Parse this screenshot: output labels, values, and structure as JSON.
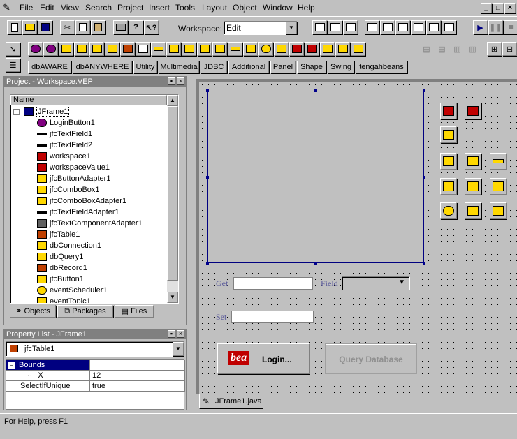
{
  "menu": [
    "File",
    "Edit",
    "View",
    "Search",
    "Project",
    "Insert",
    "Tools",
    "Layout",
    "Object",
    "Window",
    "Help"
  ],
  "toolbar": {
    "workspace_label": "Workspace:",
    "workspace_value": "Edit"
  },
  "palette_tabs": [
    "dbAWARE",
    "dbANYWHERE",
    "Utility",
    "Multimedia",
    "JDBC",
    "Additional",
    "Panel",
    "Shape",
    "Swing",
    "tengahbeans"
  ],
  "project_pane": {
    "title": "Project - Workspace.VEP",
    "column_name": "Name",
    "root": "JFrame1",
    "items": [
      "LoginButton1",
      "jfcTextField1",
      "jfcTextField2",
      "workspace1",
      "workspaceValue1",
      "jfcButtonAdapter1",
      "jfcComboBox1",
      "jfcComboBoxAdapter1",
      "jfcTextFieldAdapter1",
      "jfcTextComponentAdapter1",
      "jfcTable1",
      "dbConnection1",
      "dbQuery1",
      "dbRecord1",
      "jfcButton1",
      "eventScheduler1",
      "eventTopic1"
    ],
    "tabs": [
      "Objects",
      "Packages",
      "Files"
    ]
  },
  "property_pane": {
    "title": "Property List - JFrame1",
    "selected": "jfcTable1",
    "rows": [
      {
        "name": "Bounds",
        "value": ""
      },
      {
        "name": "X",
        "value": "12"
      },
      {
        "name": "SelectIfUnique",
        "value": "true"
      }
    ]
  },
  "designer": {
    "get_label": "Get",
    "field_label": "Field",
    "set_label": "Set",
    "login_label": "Login...",
    "bea_logo": "bea",
    "query_label": "Query Database"
  },
  "doc_tab": "JFrame1.java",
  "status": "For Help, press F1",
  "window_controls": [
    "_",
    "□",
    "×"
  ]
}
